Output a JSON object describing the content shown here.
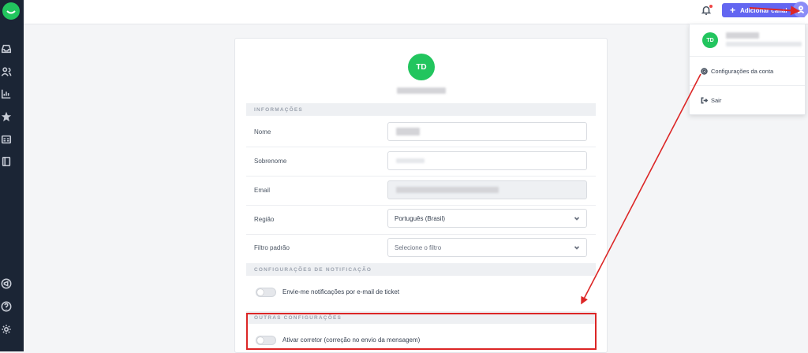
{
  "topbar": {
    "add_channel_label": "Adicionar canal"
  },
  "profile": {
    "initials": "TD"
  },
  "sections": {
    "info_title": "INFORMAÇÕES",
    "notification_title": "CONFIGURAÇÕES DE NOTIFICAÇÃO",
    "other_title": "OUTRAS CONFIGURAÇÕES"
  },
  "form": {
    "name_label": "Nome",
    "surname_label": "Sobrenome",
    "email_label": "Email",
    "region_label": "Região",
    "region_value": "Português (Brasil)",
    "filter_label": "Filtro padrão",
    "filter_placeholder": "Selecione o filtro"
  },
  "notifications": {
    "email_ticket_label": "Envie-me notificações por e-mail de ticket"
  },
  "other": {
    "spellcheck_label": "Ativar corretor (correção no envio da mensagem)"
  },
  "dropdown": {
    "initials": "TD",
    "account_settings": "Configurações da conta",
    "logout": "Sair"
  },
  "colors": {
    "sidebar": "#1b2535",
    "accent": "#6366f1",
    "avatar_green": "#22c55e",
    "annotation_red": "#dc2626"
  }
}
